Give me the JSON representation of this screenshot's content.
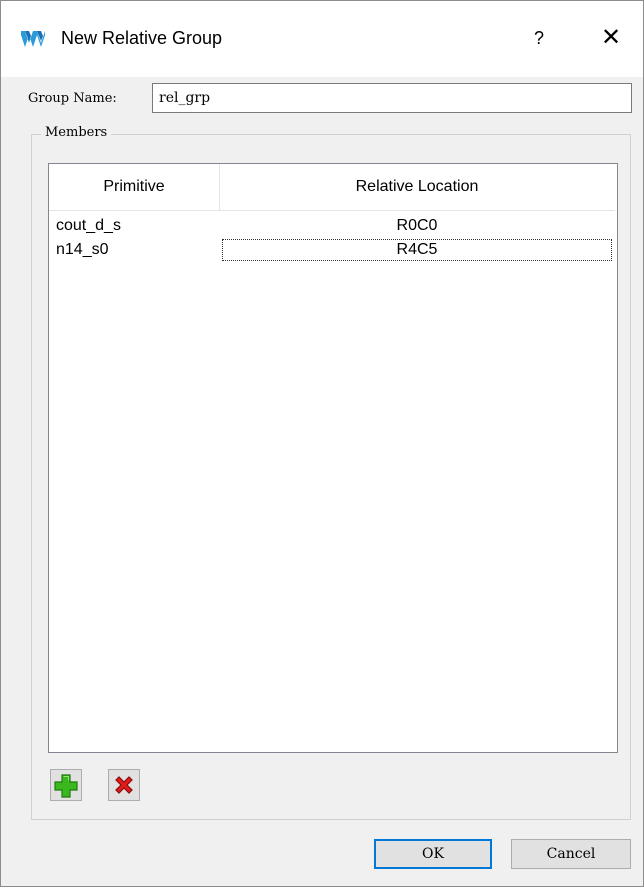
{
  "window": {
    "title": "New Relative Group",
    "help_label": "?",
    "close_label": "✕"
  },
  "form": {
    "group_name_label": "Group Name:",
    "group_name_value": "rel_grp"
  },
  "members": {
    "legend": "Members",
    "columns": [
      "Primitive",
      "Relative Location"
    ],
    "rows": [
      {
        "primitive": "cout_d_s",
        "location": "R0C0"
      },
      {
        "primitive": "n14_s0",
        "location": "R4C5"
      }
    ]
  },
  "icons": {
    "app": "gowin-logo-icon",
    "add": "add-plus-icon",
    "remove": "remove-x-icon"
  },
  "colors": {
    "add_green": "#3cb81f",
    "remove_red": "#e21b1b",
    "focus_blue": "#0078d7"
  },
  "buttons": {
    "ok": "OK",
    "cancel": "Cancel"
  }
}
